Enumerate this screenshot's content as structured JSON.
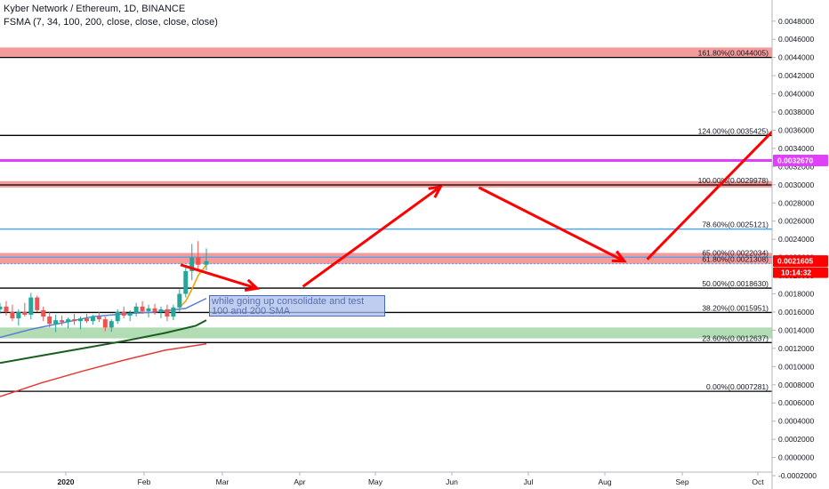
{
  "header": {
    "title": "Kyber Network / Ethereum, 1D, BINANCE",
    "indicator": "FSMA (7, 34, 100, 200, close, close, close, close)"
  },
  "annotation": "while going up consolidate and test 100 and 200 SMA",
  "colors": {
    "fib_line": "#000000",
    "fib_618_line": "#42a5f5",
    "zone_red": "#f28b8b",
    "zone_green": "#a5d6a7",
    "magenta_line": "#e040fb",
    "arrow": "#ff0000",
    "sma_orange": "#ff9800",
    "sma_blue": "#5b7fd1",
    "sma_green": "#1b5e20",
    "sma_red": "#e53935",
    "price_tag": "#ff0000"
  },
  "chart_data": {
    "type": "line",
    "title": "Kyber Network / Ethereum, 1D, BINANCE",
    "xlabel": "",
    "ylabel": "",
    "ylim": [
      -0.0002,
      0.0049
    ],
    "grid": false,
    "x_ticks": [
      "2020",
      "Feb",
      "Mar",
      "Apr",
      "May",
      "Jun",
      "Jul",
      "Aug",
      "Sep",
      "Oct"
    ],
    "y_ticks": [
      "0.0048000",
      "0.0046000",
      "0.0044000",
      "0.0042000",
      "0.0040000",
      "0.0038000",
      "0.0036000",
      "0.0034000",
      "0.0032000",
      "0.0030000",
      "0.0028000",
      "0.0026000",
      "0.0024000",
      "0.0022000",
      "0.0020000",
      "0.0018000",
      "0.0016000",
      "0.0014000",
      "0.0012000",
      "0.0010000",
      "0.0008000",
      "0.0006000",
      "0.0004000",
      "0.0002000",
      "0.0000000",
      "-0.0002000"
    ],
    "fib_levels": [
      {
        "label": "161.80%(0.0044005)",
        "value": 0.0044005
      },
      {
        "label": "124.00%(0.0035425)",
        "value": 0.0035425
      },
      {
        "label": "100.00%(0.0029978)",
        "value": 0.0029978
      },
      {
        "label": "78.60%(0.0025121)",
        "value": 0.0025121
      },
      {
        "label": "65.00%(0.0022034)",
        "value": 0.0022034
      },
      {
        "label": "61.80%(0.0021308)",
        "value": 0.0021308
      },
      {
        "label": "50.00%(0.0018630)",
        "value": 0.001863
      },
      {
        "label": "38.20%(0.0015951)",
        "value": 0.0015951
      },
      {
        "label": "23.60%(0.0012637)",
        "value": 0.0012637
      },
      {
        "label": "0.00%(0.0007281)",
        "value": 0.0007281
      }
    ],
    "zones": [
      {
        "color": "red",
        "from": 0.0044,
        "to": 0.00451
      },
      {
        "color": "red",
        "from": 0.00297,
        "to": 0.00304
      },
      {
        "color": "red",
        "from": 0.00213,
        "to": 0.00225
      },
      {
        "color": "green",
        "from": 0.00131,
        "to": 0.00143
      }
    ],
    "horizontal_line": {
      "label": "0.0032670",
      "value": 0.003267
    },
    "last_price": {
      "label": "0.0021605",
      "value": 0.0021605,
      "countdown": "10:14:32"
    },
    "projection_arrows": [
      {
        "from": [
          0.5,
          0.00212
        ],
        "to": [
          1.5,
          0.00186
        ]
      },
      {
        "from": [
          2.1,
          0.00188
        ],
        "to": [
          3.9,
          0.00298
        ]
      },
      {
        "from": [
          4.4,
          0.00297
        ],
        "to": [
          6.3,
          0.00216
        ]
      },
      {
        "from": [
          6.6,
          0.00218
        ],
        "to": [
          9.3,
          0.0045
        ]
      }
    ],
    "sma_series": [
      {
        "color": "orange",
        "x": [
          8.7,
          9.0,
          9.3,
          9.6,
          10.0
        ],
        "y": [
          0.00165,
          0.00172,
          0.00185,
          0.002,
          0.00212
        ]
      },
      {
        "color": "blue",
        "x": [
          0.0,
          1.5,
          3.0,
          4.5,
          6.0,
          7.5,
          9.0,
          10.0
        ],
        "y": [
          0.00132,
          0.00141,
          0.00148,
          0.00155,
          0.00158,
          0.0016,
          0.00164,
          0.00175
        ]
      },
      {
        "color": "green",
        "x": [
          0.0,
          2.0,
          4.0,
          6.0,
          8.0,
          9.5,
          10.0
        ],
        "y": [
          0.00104,
          0.00112,
          0.0012,
          0.00128,
          0.00137,
          0.00145,
          0.00151
        ]
      },
      {
        "color": "red",
        "x": [
          0.0,
          2.0,
          4.0,
          6.0,
          8.0,
          10.0
        ],
        "y": [
          0.00067,
          0.00082,
          0.00095,
          0.00107,
          0.00118,
          0.00125
        ]
      }
    ],
    "candles": [
      {
        "x": 0.0,
        "o": 0.00163,
        "h": 0.0017,
        "l": 0.00158,
        "c": 0.00166
      },
      {
        "x": 0.3,
        "o": 0.00166,
        "h": 0.00172,
        "l": 0.00156,
        "c": 0.0016
      },
      {
        "x": 0.6,
        "o": 0.0016,
        "h": 0.00168,
        "l": 0.0015,
        "c": 0.00153
      },
      {
        "x": 0.9,
        "o": 0.00153,
        "h": 0.00163,
        "l": 0.00145,
        "c": 0.0016
      },
      {
        "x": 1.2,
        "o": 0.0016,
        "h": 0.0017,
        "l": 0.00155,
        "c": 0.00157
      },
      {
        "x": 1.5,
        "o": 0.00157,
        "h": 0.00181,
        "l": 0.00152,
        "c": 0.00176
      },
      {
        "x": 1.8,
        "o": 0.00176,
        "h": 0.00178,
        "l": 0.0016,
        "c": 0.00162
      },
      {
        "x": 2.1,
        "o": 0.00162,
        "h": 0.00166,
        "l": 0.0015,
        "c": 0.00155
      },
      {
        "x": 2.4,
        "o": 0.00155,
        "h": 0.0016,
        "l": 0.00143,
        "c": 0.00147
      },
      {
        "x": 2.7,
        "o": 0.00147,
        "h": 0.00157,
        "l": 0.00138,
        "c": 0.00151
      },
      {
        "x": 3.0,
        "o": 0.00151,
        "h": 0.00156,
        "l": 0.00145,
        "c": 0.00149
      },
      {
        "x": 3.3,
        "o": 0.00149,
        "h": 0.00154,
        "l": 0.00142,
        "c": 0.00152
      },
      {
        "x": 3.6,
        "o": 0.00152,
        "h": 0.00158,
        "l": 0.00146,
        "c": 0.0015
      },
      {
        "x": 3.9,
        "o": 0.0015,
        "h": 0.00155,
        "l": 0.00141,
        "c": 0.00153
      },
      {
        "x": 4.2,
        "o": 0.00153,
        "h": 0.00158,
        "l": 0.00148,
        "c": 0.0015
      },
      {
        "x": 4.5,
        "o": 0.0015,
        "h": 0.00157,
        "l": 0.00146,
        "c": 0.00155
      },
      {
        "x": 4.8,
        "o": 0.00155,
        "h": 0.0016,
        "l": 0.00149,
        "c": 0.00152
      },
      {
        "x": 5.1,
        "o": 0.00152,
        "h": 0.00155,
        "l": 0.00139,
        "c": 0.00143
      },
      {
        "x": 5.4,
        "o": 0.00143,
        "h": 0.00152,
        "l": 0.00138,
        "c": 0.0015
      },
      {
        "x": 5.7,
        "o": 0.0015,
        "h": 0.00163,
        "l": 0.00147,
        "c": 0.0016
      },
      {
        "x": 6.0,
        "o": 0.0016,
        "h": 0.00166,
        "l": 0.00153,
        "c": 0.00156
      },
      {
        "x": 6.3,
        "o": 0.00156,
        "h": 0.00162,
        "l": 0.0015,
        "c": 0.00159
      },
      {
        "x": 6.6,
        "o": 0.00159,
        "h": 0.0017,
        "l": 0.00155,
        "c": 0.00166
      },
      {
        "x": 6.9,
        "o": 0.00166,
        "h": 0.00172,
        "l": 0.00158,
        "c": 0.00161
      },
      {
        "x": 7.2,
        "o": 0.00161,
        "h": 0.00168,
        "l": 0.00154,
        "c": 0.00164
      },
      {
        "x": 7.5,
        "o": 0.00164,
        "h": 0.00169,
        "l": 0.00157,
        "c": 0.0016
      },
      {
        "x": 7.8,
        "o": 0.0016,
        "h": 0.00166,
        "l": 0.00153,
        "c": 0.00163
      },
      {
        "x": 8.1,
        "o": 0.00163,
        "h": 0.00168,
        "l": 0.0015,
        "c": 0.00155
      },
      {
        "x": 8.4,
        "o": 0.00155,
        "h": 0.00168,
        "l": 0.00151,
        "c": 0.00165
      },
      {
        "x": 8.7,
        "o": 0.00165,
        "h": 0.00185,
        "l": 0.0016,
        "c": 0.0018
      },
      {
        "x": 9.0,
        "o": 0.0018,
        "h": 0.0021,
        "l": 0.00176,
        "c": 0.00205
      },
      {
        "x": 9.3,
        "o": 0.00205,
        "h": 0.00235,
        "l": 0.00195,
        "c": 0.0022
      },
      {
        "x": 9.6,
        "o": 0.0022,
        "h": 0.00238,
        "l": 0.00205,
        "c": 0.00212
      },
      {
        "x": 10.0,
        "o": 0.00212,
        "h": 0.0023,
        "l": 0.00206,
        "c": 0.00216
      }
    ]
  }
}
